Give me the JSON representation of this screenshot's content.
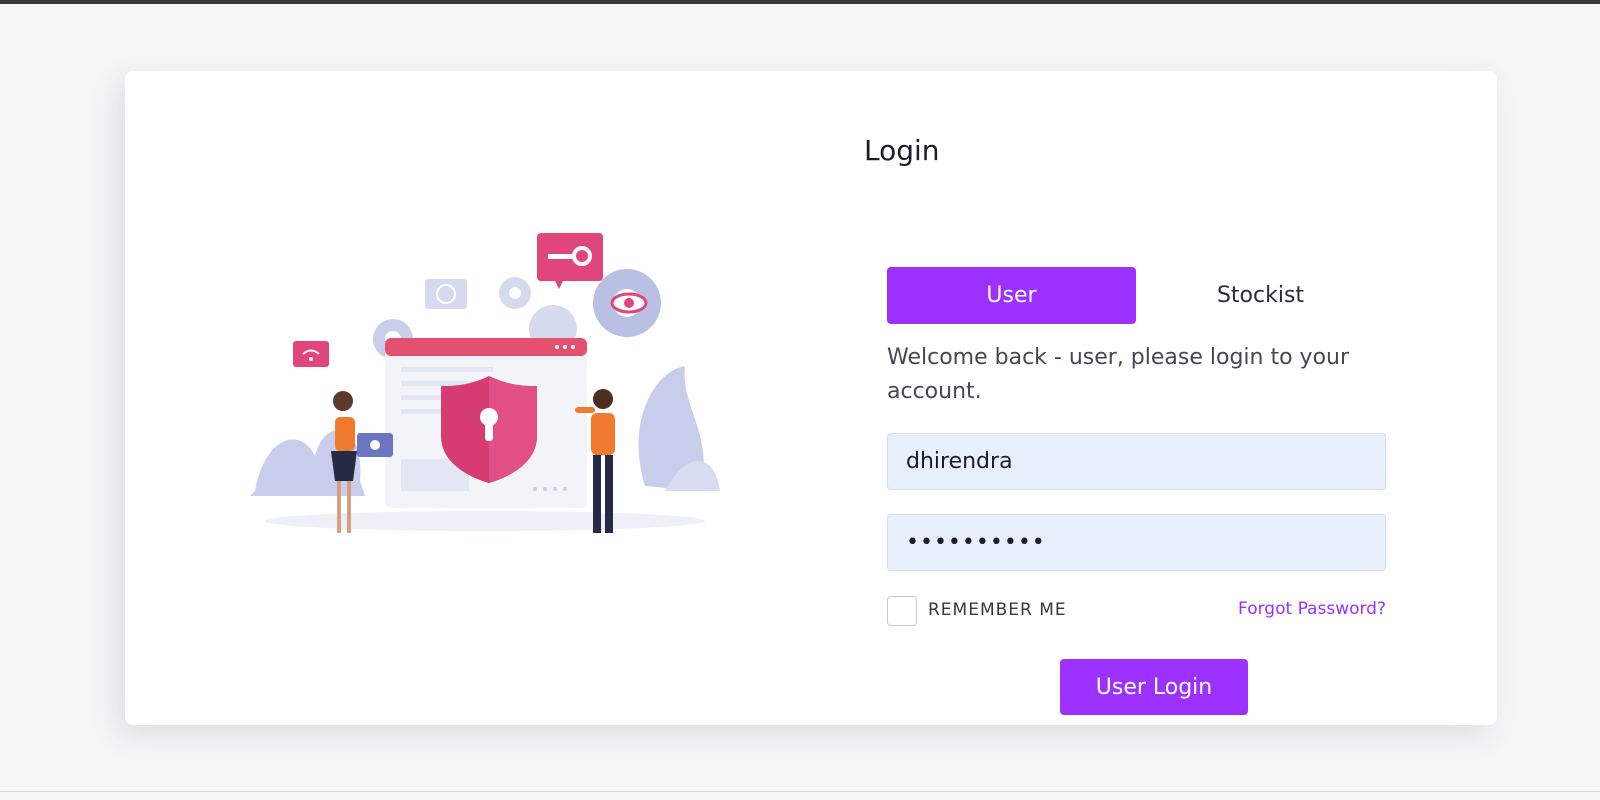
{
  "login": {
    "title": "Login",
    "tabs": [
      {
        "label": "User",
        "active": true
      },
      {
        "label": "Stockist",
        "active": false
      }
    ],
    "welcome": "Welcome back - user, please login to your account.",
    "username_value": "dhirendra",
    "password_mask": "••••••••••",
    "remember_label": "REMEMBER ME",
    "remember_checked": false,
    "forgot_label": "Forgot Password?",
    "submit_label": "User Login"
  },
  "colors": {
    "accent": "#9b30ff",
    "input_bg": "#e8effd",
    "page_bg": "#f6f6f7",
    "card_bg": "#ffffff"
  },
  "illustration": {
    "name": "security-illustration"
  }
}
